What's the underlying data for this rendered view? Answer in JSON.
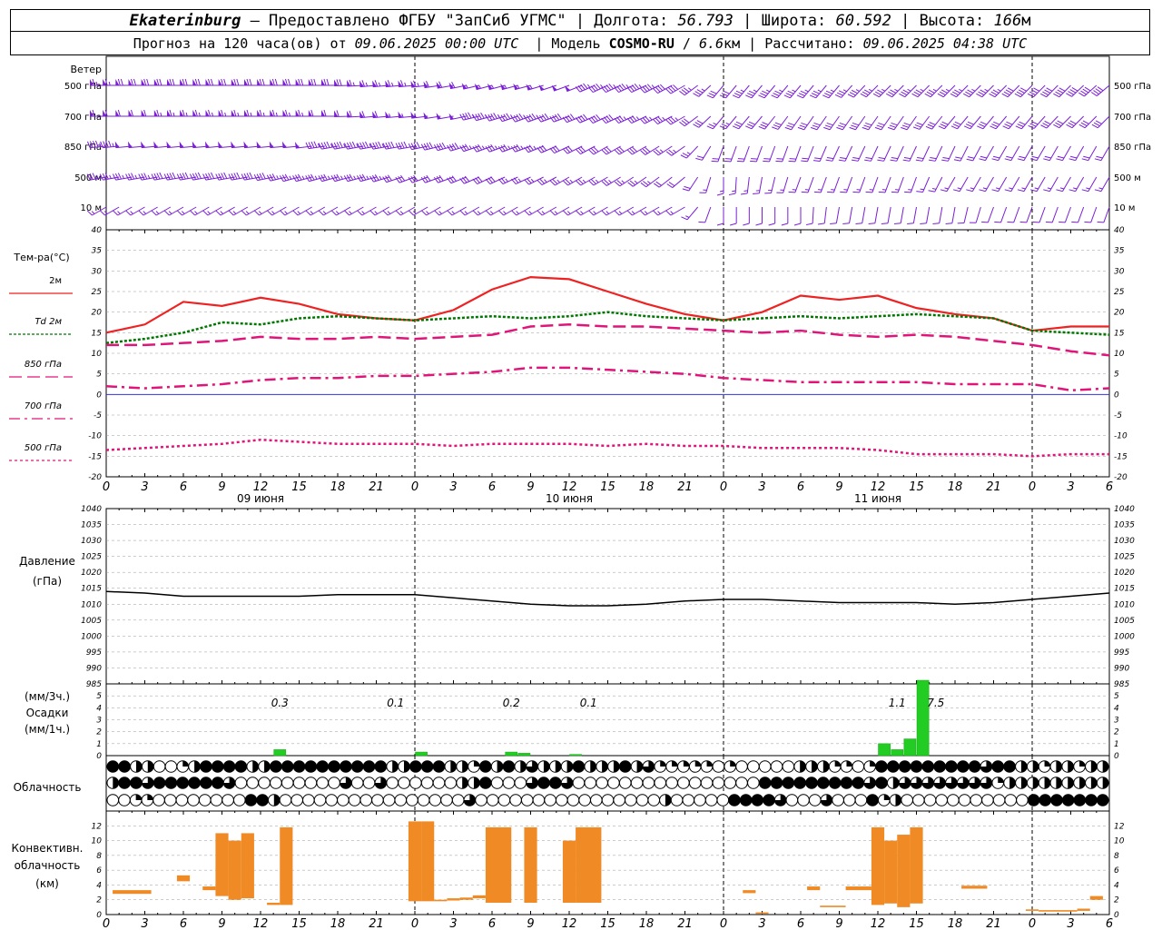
{
  "header": {
    "city": "Ekaterinburg",
    "provider": "– Предоставлено ФГБУ \"ЗапСиб УГМС\"",
    "lon_label": "Долгота:",
    "lon": "56.793",
    "lat_label": "Широта:",
    "lat": "60.592",
    "alt_label": "Высота:",
    "alt": "166",
    "alt_unit": "м",
    "forecast_label": "Прогноз на 120 часа(ов) от",
    "start": "09.06.2025 00:00 UTC",
    "model_label": "Модель",
    "model": "COSMO-RU",
    "resolution": "6.6",
    "resolution_unit": "км",
    "calc_label": "Рассчитано:",
    "calc_time": "09.06.2025 04:38 UTC"
  },
  "colors": {
    "t2m": "#ee2222",
    "td": "#007700",
    "p850": "#e0157a",
    "wind": "#7a1fd6",
    "precip": "#22cc22",
    "conv": "#f08a24",
    "grid": "#999999",
    "zero_line": "#3333dd"
  },
  "labels": {
    "wind": "Ветер",
    "wind_levels": [
      "500 гПа",
      "700 гПа",
      "850 гПа",
      "500 м",
      "10 м"
    ],
    "temp_title": "Тем-ра(°C)",
    "temp_series": [
      "2м",
      "Td 2м",
      "850 гПа",
      "700 гПа",
      "500 гПа"
    ],
    "pressure_title": "Давление",
    "pressure_unit": "(гПа)",
    "precip_unit3": "(мм/3ч.)",
    "precip_title": "Осадки",
    "precip_unit1": "(мм/1ч.)",
    "cloud_title": "Облачность",
    "conv_title": [
      "Конвективн.",
      "облачность",
      "(км)"
    ],
    "hour_ticks": [
      "0",
      "3",
      "6",
      "9",
      "12",
      "15",
      "18",
      "21",
      "0",
      "3",
      "6",
      "9",
      "12",
      "15",
      "18",
      "21",
      "0",
      "3",
      "6",
      "9",
      "12",
      "15",
      "18",
      "21",
      "0",
      "3",
      "6"
    ],
    "days": [
      "09 июня",
      "10 июня",
      "11 июня"
    ]
  },
  "chart_data": [
    {
      "type": "line",
      "title": "Тем-ра(°C)",
      "x": [
        0,
        3,
        6,
        9,
        12,
        15,
        18,
        21,
        24,
        27,
        30,
        33,
        36,
        39,
        42,
        45,
        48,
        51,
        54,
        57,
        60,
        63,
        66,
        69,
        72,
        75,
        78
      ],
      "ylim": [
        -20,
        40
      ],
      "series": [
        {
          "name": "2м",
          "values": [
            15.0,
            17.0,
            22.5,
            21.5,
            23.5,
            22.0,
            19.5,
            18.5,
            18.0,
            20.5,
            25.5,
            28.5,
            28.0,
            25.0,
            22.0,
            19.5,
            18.0,
            20.0,
            24.0,
            23.0,
            24.0,
            21.0,
            19.5,
            18.5,
            15.5,
            16.5,
            16.5
          ]
        },
        {
          "name": "Td 2м",
          "values": [
            12.5,
            13.5,
            15.0,
            17.5,
            17.0,
            18.5,
            19.0,
            18.5,
            18.0,
            18.5,
            19.0,
            18.5,
            19.0,
            20.0,
            19.0,
            18.5,
            18.0,
            18.5,
            19.0,
            18.5,
            19.0,
            19.5,
            19.0,
            18.5,
            15.5,
            15.0,
            14.5
          ]
        },
        {
          "name": "850 гПа",
          "values": [
            12.0,
            12.0,
            12.5,
            13.0,
            14.0,
            13.5,
            13.5,
            14.0,
            13.5,
            14.0,
            14.5,
            16.5,
            17.0,
            16.5,
            16.5,
            16.0,
            15.5,
            15.0,
            15.5,
            14.5,
            14.0,
            14.5,
            14.0,
            13.0,
            12.0,
            10.5,
            9.5
          ]
        },
        {
          "name": "700 гПа",
          "values": [
            2.0,
            1.5,
            2.0,
            2.5,
            3.5,
            4.0,
            4.0,
            4.5,
            4.5,
            5.0,
            5.5,
            6.5,
            6.5,
            6.0,
            5.5,
            5.0,
            4.0,
            3.5,
            3.0,
            3.0,
            3.0,
            3.0,
            2.5,
            2.5,
            2.5,
            1.0,
            1.5
          ]
        },
        {
          "name": "500 гПа",
          "values": [
            -13.5,
            -13.0,
            -12.5,
            -12.0,
            -11.0,
            -11.5,
            -12.0,
            -12.0,
            -12.0,
            -12.5,
            -12.0,
            -12.0,
            -12.0,
            -12.5,
            -12.0,
            -12.5,
            -12.5,
            -13.0,
            -13.0,
            -13.0,
            -13.5,
            -14.5,
            -14.5,
            -14.5,
            -15.0,
            -14.5,
            -14.5
          ]
        }
      ]
    },
    {
      "type": "line",
      "title": "Давление",
      "ylabel": "(гПа)",
      "x": [
        0,
        3,
        6,
        9,
        12,
        15,
        18,
        21,
        24,
        27,
        30,
        33,
        36,
        39,
        42,
        45,
        48,
        51,
        54,
        57,
        60,
        63,
        66,
        69,
        72,
        75,
        78
      ],
      "ylim": [
        985,
        1040
      ],
      "series": [
        {
          "name": "",
          "values": [
            1014.0,
            1013.5,
            1012.5,
            1012.5,
            1012.5,
            1012.5,
            1013.0,
            1013.0,
            1013.0,
            1012.0,
            1011.0,
            1010.0,
            1009.5,
            1009.5,
            1010.0,
            1011.0,
            1011.5,
            1011.5,
            1011.0,
            1010.5,
            1010.5,
            1010.5,
            1010.0,
            1010.5,
            1011.5,
            1012.5,
            1013.5
          ]
        }
      ]
    },
    {
      "type": "bar",
      "title": "Осадки",
      "ylabel": "(мм/1ч.)",
      "ylim": [
        0,
        6
      ],
      "x": [
        13,
        24,
        31,
        32,
        36,
        60,
        61,
        62,
        63
      ],
      "values": [
        0.5,
        0.3,
        0.3,
        0.2,
        0.1,
        1.0,
        0.5,
        1.4,
        6.3
      ],
      "annotations_3h": [
        {
          "x": 13.5,
          "label": "0.3"
        },
        {
          "x": 22.5,
          "label": "0.1"
        },
        {
          "x": 31.5,
          "label": "0.2"
        },
        {
          "x": 37.5,
          "label": "0.1"
        },
        {
          "x": 61.5,
          "label": "1.1"
        },
        {
          "x": 64.5,
          "label": "7.5"
        }
      ]
    },
    {
      "type": "table",
      "title": "Облачность",
      "rows": [
        "FFHHOOQHFFFFHHFFFFFFFFFFHHFFFHHQFHFHTHHHFHHHFHTQQQQQOQOOOOOHHHQQOQFFFFFFFFFTFFHHQHHQHH",
        "HFFTFFFFFFTOOOOOOOOOTOOTOOOOOOHHFOOOTFFTOOOOOOOOOOOOOOOOFFFFFFFFFTFHTTTTTTTTQHHHHHHHHH",
        "OOQQOOOOOOOOFFHOOOOOOOOOOOOOOOOTOOOOOOOOOOOOOOOOHOOOOOFFFFTOOOTOOOFQHOOOOOOOOOOOFFFFFFF"
      ]
    },
    {
      "type": "bar",
      "title": "Конвективн. облачность",
      "ylabel": "(км)",
      "ylim": [
        0,
        13
      ],
      "segments": [
        {
          "x0": 0.5,
          "x1": 3.5,
          "base": 2.8,
          "top": 3.3
        },
        {
          "x0": 5.5,
          "x1": 6.5,
          "base": 4.5,
          "top": 5.3
        },
        {
          "x0": 7.5,
          "x1": 8.5,
          "base": 3.3,
          "top": 3.8
        },
        {
          "x0": 8.5,
          "x1": 9.5,
          "base": 2.5,
          "top": 11.0
        },
        {
          "x0": 9.5,
          "x1": 10.5,
          "base": 2.0,
          "top": 10.0
        },
        {
          "x0": 10.5,
          "x1": 11.5,
          "base": 2.2,
          "top": 11.0
        },
        {
          "x0": 12.5,
          "x1": 13.5,
          "base": 1.3,
          "top": 1.6
        },
        {
          "x0": 13.5,
          "x1": 14.5,
          "base": 1.3,
          "top": 11.8
        },
        {
          "x0": 23.5,
          "x1": 24.5,
          "base": 1.8,
          "top": 12.6
        },
        {
          "x0": 24.5,
          "x1": 25.5,
          "base": 1.8,
          "top": 12.6
        },
        {
          "x0": 25.5,
          "x1": 26.5,
          "base": 1.8,
          "top": 2.0
        },
        {
          "x0": 26.5,
          "x1": 27.5,
          "base": 1.9,
          "top": 2.2
        },
        {
          "x0": 27.5,
          "x1": 28.5,
          "base": 2.0,
          "top": 2.3
        },
        {
          "x0": 28.5,
          "x1": 29.5,
          "base": 2.2,
          "top": 2.6
        },
        {
          "x0": 29.5,
          "x1": 31.5,
          "base": 1.6,
          "top": 11.8
        },
        {
          "x0": 32.5,
          "x1": 33.5,
          "base": 1.6,
          "top": 11.8
        },
        {
          "x0": 35.5,
          "x1": 36.5,
          "base": 1.6,
          "top": 10.0
        },
        {
          "x0": 36.5,
          "x1": 38.5,
          "base": 1.6,
          "top": 11.8
        },
        {
          "x0": 49.5,
          "x1": 50.5,
          "base": 2.9,
          "top": 3.3
        },
        {
          "x0": 50.5,
          "x1": 51.5,
          "base": 0.1,
          "top": 0.3
        },
        {
          "x0": 54.5,
          "x1": 55.5,
          "base": 3.3,
          "top": 3.8
        },
        {
          "x0": 55.5,
          "x1": 57.5,
          "base": 1.0,
          "top": 1.2
        },
        {
          "x0": 57.5,
          "x1": 59.5,
          "base": 3.3,
          "top": 3.8
        },
        {
          "x0": 59.5,
          "x1": 60.5,
          "base": 1.3,
          "top": 11.8
        },
        {
          "x0": 60.5,
          "x1": 61.5,
          "base": 1.5,
          "top": 10.0
        },
        {
          "x0": 61.5,
          "x1": 62.5,
          "base": 1.0,
          "top": 10.8
        },
        {
          "x0": 62.5,
          "x1": 63.5,
          "base": 1.5,
          "top": 11.8
        },
        {
          "x0": 66.5,
          "x1": 68.5,
          "base": 3.5,
          "top": 3.9
        },
        {
          "x0": 71.5,
          "x1": 72.5,
          "base": 0.5,
          "top": 0.7
        },
        {
          "x0": 72.5,
          "x1": 75.5,
          "base": 0.4,
          "top": 0.6
        },
        {
          "x0": 75.5,
          "x1": 76.5,
          "base": 0.5,
          "top": 0.8
        },
        {
          "x0": 76.5,
          "x1": 77.5,
          "base": 2.0,
          "top": 2.5
        }
      ]
    }
  ],
  "wind_rows": [
    {
      "level": "500 гПа",
      "speed": [
        65,
        70,
        70,
        70,
        70,
        70,
        70,
        65,
        65,
        60,
        55,
        55,
        50,
        45,
        45,
        40,
        30,
        35,
        35,
        35,
        35,
        35,
        35,
        35,
        40,
        40,
        40
      ],
      "dir": [
        270,
        270,
        270,
        270,
        270,
        270,
        270,
        265,
        265,
        260,
        255,
        255,
        250,
        245,
        245,
        240,
        220,
        220,
        220,
        220,
        225,
        225,
        225,
        225,
        225,
        225,
        230
      ]
    },
    {
      "level": "700 гПа",
      "speed": [
        60,
        60,
        65,
        65,
        65,
        65,
        60,
        60,
        55,
        50,
        45,
        45,
        40,
        40,
        35,
        35,
        25,
        30,
        30,
        30,
        30,
        30,
        30,
        30,
        30,
        30,
        30
      ],
      "dir": [
        270,
        270,
        270,
        270,
        270,
        270,
        270,
        265,
        265,
        260,
        255,
        250,
        250,
        245,
        245,
        240,
        220,
        220,
        215,
        215,
        215,
        215,
        220,
        220,
        220,
        225,
        225
      ]
    },
    {
      "level": "850 гПа",
      "speed": [
        45,
        50,
        50,
        50,
        50,
        50,
        45,
        45,
        40,
        40,
        35,
        35,
        30,
        30,
        30,
        25,
        20,
        20,
        20,
        20,
        20,
        20,
        20,
        20,
        20,
        20,
        20
      ],
      "dir": [
        265,
        265,
        265,
        265,
        265,
        265,
        260,
        260,
        260,
        255,
        250,
        250,
        245,
        240,
        240,
        235,
        200,
        200,
        200,
        205,
        205,
        205,
        205,
        210,
        210,
        210,
        210
      ]
    },
    {
      "level": "500 м",
      "speed": [
        35,
        35,
        40,
        40,
        40,
        35,
        35,
        35,
        30,
        30,
        30,
        25,
        25,
        25,
        25,
        20,
        15,
        15,
        15,
        15,
        15,
        15,
        15,
        15,
        15,
        15,
        15
      ],
      "dir": [
        260,
        260,
        260,
        260,
        260,
        255,
        255,
        255,
        250,
        250,
        245,
        245,
        240,
        240,
        235,
        230,
        180,
        190,
        200,
        200,
        200,
        200,
        210,
        210,
        210,
        210,
        210
      ]
    },
    {
      "level": "10 м",
      "speed": [
        15,
        15,
        15,
        15,
        15,
        15,
        15,
        15,
        15,
        15,
        15,
        15,
        15,
        15,
        15,
        15,
        10,
        10,
        10,
        10,
        10,
        10,
        10,
        10,
        10,
        10,
        10
      ],
      "dir": [
        240,
        240,
        240,
        240,
        240,
        240,
        240,
        240,
        240,
        240,
        240,
        240,
        240,
        240,
        240,
        240,
        180,
        180,
        180,
        190,
        190,
        190,
        190,
        200,
        200,
        200,
        200
      ]
    }
  ]
}
